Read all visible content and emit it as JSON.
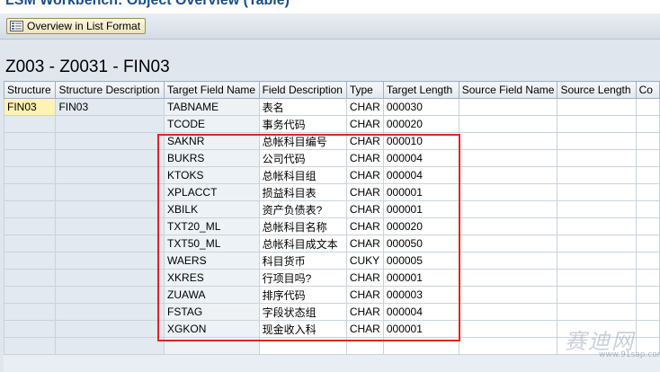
{
  "window": {
    "title": "LSM Workbench: Object Overview (Table)"
  },
  "toolbar": {
    "overview_button_label": "Overview in List Format",
    "overview_icon": "list-overview-icon"
  },
  "section": {
    "title": "Z003 - Z0031 - FIN03"
  },
  "grid": {
    "columns": [
      "Structure",
      "Structure Description",
      "Target Field Name",
      "Field Description",
      "Type",
      "Target Length",
      "Source Field Name",
      "Source Length",
      "Co"
    ],
    "rows": [
      [
        "FIN03",
        "FIN03",
        "TABNAME",
        "表名",
        "CHAR",
        "000030",
        "",
        "",
        ""
      ],
      [
        "",
        "",
        "TCODE",
        "事务代码",
        "CHAR",
        "000020",
        "",
        "",
        ""
      ],
      [
        "",
        "",
        "SAKNR",
        "总帐科目编号",
        "CHAR",
        "000010",
        "",
        "",
        ""
      ],
      [
        "",
        "",
        "BUKRS",
        "公司代码",
        "CHAR",
        "000004",
        "",
        "",
        ""
      ],
      [
        "",
        "",
        "KTOKS",
        "总帐科目组",
        "CHAR",
        "000004",
        "",
        "",
        ""
      ],
      [
        "",
        "",
        "XPLACCT",
        "损益科目表",
        "CHAR",
        "000001",
        "",
        "",
        ""
      ],
      [
        "",
        "",
        "XBILK",
        "资产负债表?",
        "CHAR",
        "000001",
        "",
        "",
        ""
      ],
      [
        "",
        "",
        "TXT20_ML",
        "总帐科目名称",
        "CHAR",
        "000020",
        "",
        "",
        ""
      ],
      [
        "",
        "",
        "TXT50_ML",
        "总帐科目成文本",
        "CHAR",
        "000050",
        "",
        "",
        ""
      ],
      [
        "",
        "",
        "WAERS",
        "科目货币",
        "CUKY",
        "000005",
        "",
        "",
        ""
      ],
      [
        "",
        "",
        "XKRES",
        "行项目吗?",
        "CHAR",
        "000001",
        "",
        "",
        ""
      ],
      [
        "",
        "",
        "ZUAWA",
        "排序代码",
        "CHAR",
        "000003",
        "",
        "",
        ""
      ],
      [
        "",
        "",
        "FSTAG",
        "字段状态组",
        "CHAR",
        "000004",
        "",
        "",
        ""
      ],
      [
        "",
        "",
        "XGKON",
        "现金收入科",
        "CHAR",
        "000001",
        "",
        "",
        ""
      ],
      [
        "",
        "",
        "",
        "",
        "",
        "",
        "",
        "",
        ""
      ]
    ]
  },
  "watermark": {
    "text": "赛迪网",
    "url": "www.91sap.com"
  },
  "colors": {
    "highlight": "#e02424",
    "selected_cell": "#fff3b3",
    "title_blue": "#1c4f86"
  }
}
